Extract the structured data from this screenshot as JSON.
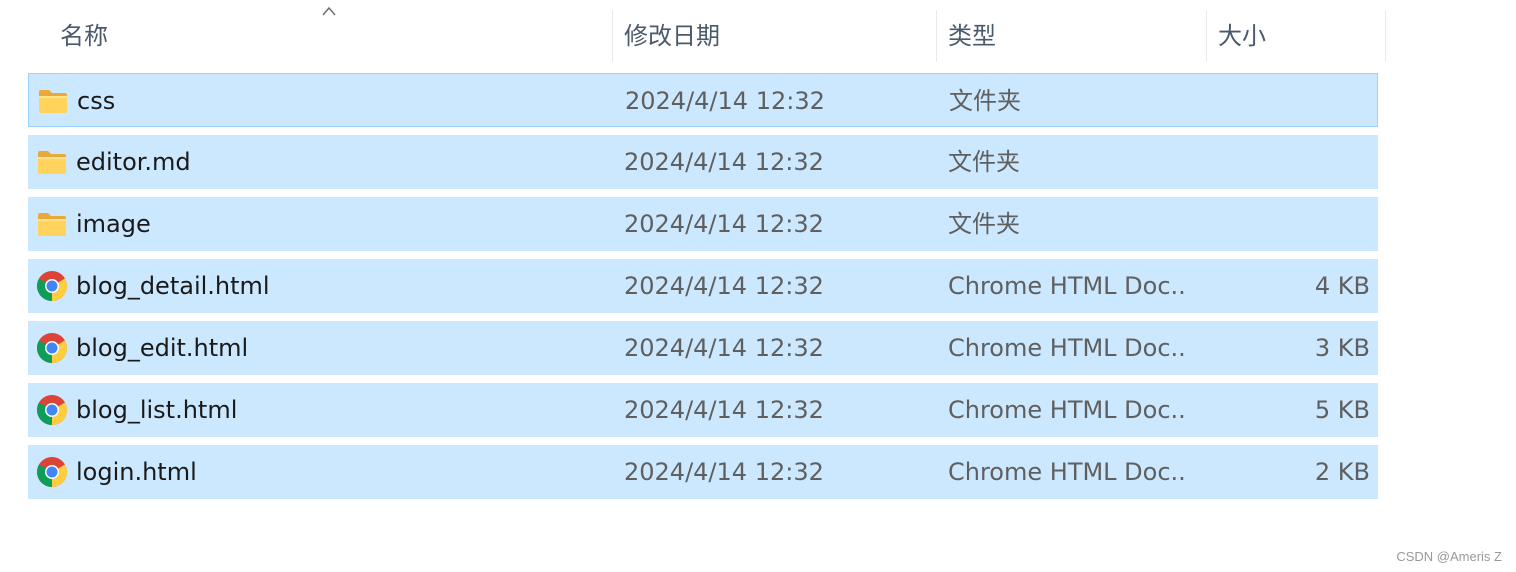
{
  "columns": {
    "name": "名称",
    "date": "修改日期",
    "type": "类型",
    "size": "大小"
  },
  "sort_indicator": "chevron-up-icon",
  "files": [
    {
      "name": "css",
      "date": "2024/4/14 12:32",
      "type": "文件夹",
      "size": "",
      "icon": "folder-icon"
    },
    {
      "name": "editor.md",
      "date": "2024/4/14 12:32",
      "type": "文件夹",
      "size": "",
      "icon": "folder-icon"
    },
    {
      "name": "image",
      "date": "2024/4/14 12:32",
      "type": "文件夹",
      "size": "",
      "icon": "folder-icon"
    },
    {
      "name": "blog_detail.html",
      "date": "2024/4/14 12:32",
      "type": "Chrome HTML Doc...",
      "size": "4 KB",
      "icon": "chrome-icon"
    },
    {
      "name": "blog_edit.html",
      "date": "2024/4/14 12:32",
      "type": "Chrome HTML Doc...",
      "size": "3 KB",
      "icon": "chrome-icon"
    },
    {
      "name": "blog_list.html",
      "date": "2024/4/14 12:32",
      "type": "Chrome HTML Doc...",
      "size": "5 KB",
      "icon": "chrome-icon"
    },
    {
      "name": "login.html",
      "date": "2024/4/14 12:32",
      "type": "Chrome HTML Doc...",
      "size": "2 KB",
      "icon": "chrome-icon"
    }
  ],
  "colors": {
    "selection": "#cce8ff",
    "selection_border": "#99d1ff",
    "header_text": "#4a5a6c"
  },
  "watermark": "CSDN @Ameris Z"
}
